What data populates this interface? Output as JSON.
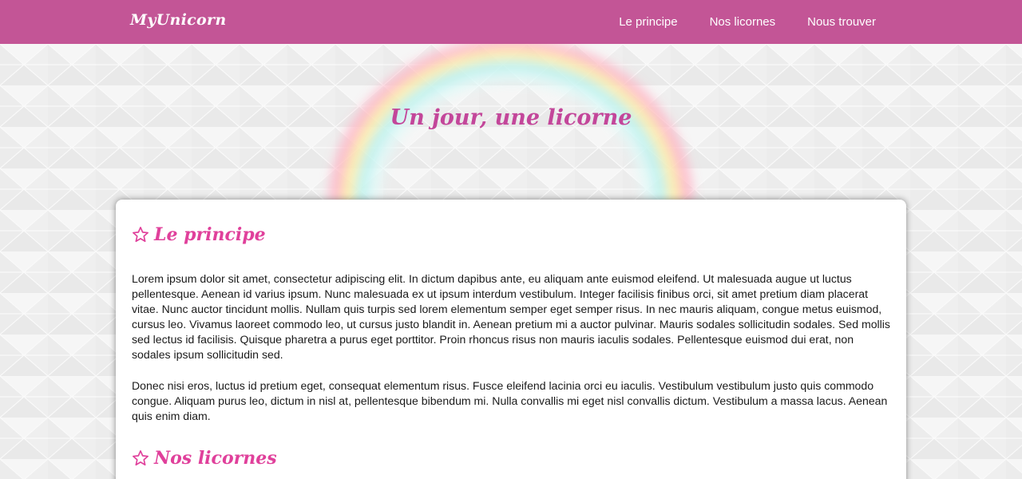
{
  "nav": {
    "brand": "MyUnicorn",
    "links": [
      "Le principe",
      "Nos licornes",
      "Nous trouver"
    ]
  },
  "hero": {
    "title": "Un jour, une licorne"
  },
  "sections": [
    {
      "icon": "star-icon",
      "title": "Le principe",
      "paragraphs": [
        "Lorem ipsum dolor sit amet, consectetur adipiscing elit. In dictum dapibus ante, eu aliquam ante euismod eleifend. Ut malesuada augue ut luctus pellentesque. Aenean id varius ipsum. Nunc malesuada ex ut ipsum interdum vestibulum. Integer facilisis finibus orci, sit amet pretium diam placerat vitae. Nunc auctor tincidunt mollis. Nullam quis turpis sed lorem elementum semper eget semper risus. In nec mauris aliquam, congue metus euismod, cursus leo. Vivamus laoreet commodo leo, ut cursus justo blandit in. Aenean pretium mi a auctor pulvinar. Mauris sodales sollicitudin sodales. Sed mollis sed lectus id facilisis. Quisque pharetra a purus eget porttitor. Proin rhoncus risus non mauris iaculis sodales. Pellentesque euismod dui erat, non sodales ipsum sollicitudin sed.",
        "Donec nisi eros, luctus id pretium eget, consequat elementum risus. Fusce eleifend lacinia orci eu iaculis. Vestibulum vestibulum justo quis commodo congue. Aliquam purus leo, dictum in nisl at, pellentesque bibendum mi. Nulla convallis mi eget nisl convallis dictum. Vestibulum a massa lacus. Aenean quis enim diam."
      ]
    },
    {
      "icon": "star-icon",
      "title": "Nos licornes"
    }
  ],
  "colors": {
    "navbar": "#c35596",
    "accent": "#e0409b",
    "hero_title": "#c3469a"
  }
}
